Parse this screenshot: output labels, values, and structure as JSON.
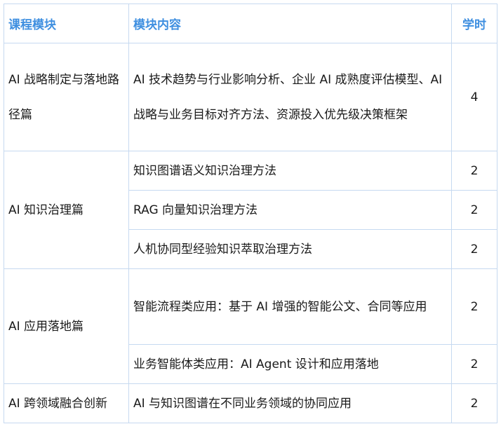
{
  "header": {
    "module": "课程模块",
    "content": "模块内容",
    "hours": "学时"
  },
  "groups": [
    {
      "module": "AI 战略制定与落地路径篇",
      "items": [
        {
          "content": "AI 技术趋势与行业影响分析、企业 AI 成熟度评估模型、AI 战略与业务目标对齐方法、资源投入优先级决策框架",
          "hours": "4"
        }
      ]
    },
    {
      "module": "AI 知识治理篇",
      "items": [
        {
          "content": "知识图谱语义知识治理方法",
          "hours": "2"
        },
        {
          "content": "RAG 向量知识治理方法",
          "hours": "2"
        },
        {
          "content": "人机协同型经验知识萃取治理方法",
          "hours": "2"
        }
      ]
    },
    {
      "module": "AI 应用落地篇",
      "items": [
        {
          "content": "智能流程类应用：基于 AI 增强的智能公文、合同等应用",
          "hours": "2"
        },
        {
          "content": "业务智能体类应用：AI Agent 设计和应用落地",
          "hours": "2"
        }
      ]
    },
    {
      "module": "AI 跨领域融合创新",
      "items": [
        {
          "content": "AI 与知识图谱在不同业务领域的协同应用",
          "hours": "2"
        }
      ]
    }
  ]
}
